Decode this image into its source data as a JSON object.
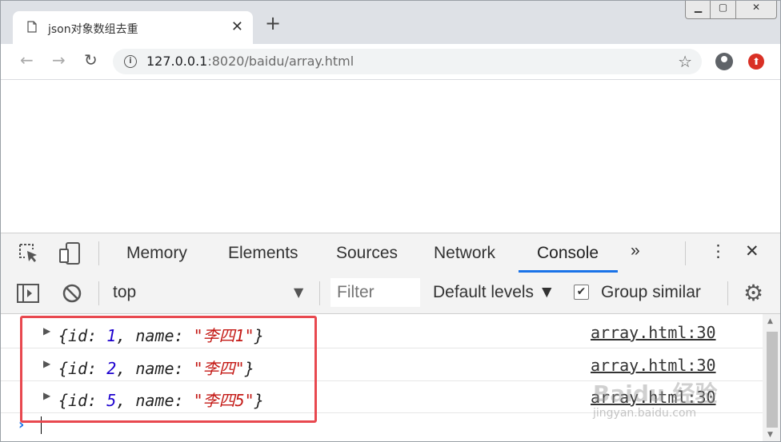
{
  "tab": {
    "title": "json对象数组去重",
    "close": "✕"
  },
  "new_tab": "+",
  "address": {
    "host": "127.0.0.1",
    "rest": ":8020/baidu/array.html"
  },
  "devtools": {
    "tabs": [
      "Memory",
      "Elements",
      "Sources",
      "Network",
      "Console"
    ],
    "more": "»",
    "active_tab": "Console",
    "context": "top",
    "filter_placeholder": "Filter",
    "levels": "Default levels ▼",
    "group_similar": "Group similar"
  },
  "console": {
    "rows": [
      {
        "prefix": "{id: ",
        "id": "1",
        "mid": ", name: ",
        "name": "\"李四1\"",
        "suffix": "}",
        "source": "array.html:30"
      },
      {
        "prefix": "{id: ",
        "id": "2",
        "mid": ", name: ",
        "name": "\"李四\"",
        "suffix": "}",
        "source": "array.html:30"
      },
      {
        "prefix": "{id: ",
        "id": "5",
        "mid": ", name: ",
        "name": "\"李四5\"",
        "suffix": "}",
        "source": "array.html:30"
      }
    ],
    "prompt": "›"
  },
  "watermark": {
    "brand": "Baidu 经验",
    "site": "jingyan.baidu.com"
  },
  "colors": {
    "accent": "#1a73e8",
    "highlight": "#e8484f",
    "number": "#1c00cf",
    "string": "#c41a16"
  }
}
